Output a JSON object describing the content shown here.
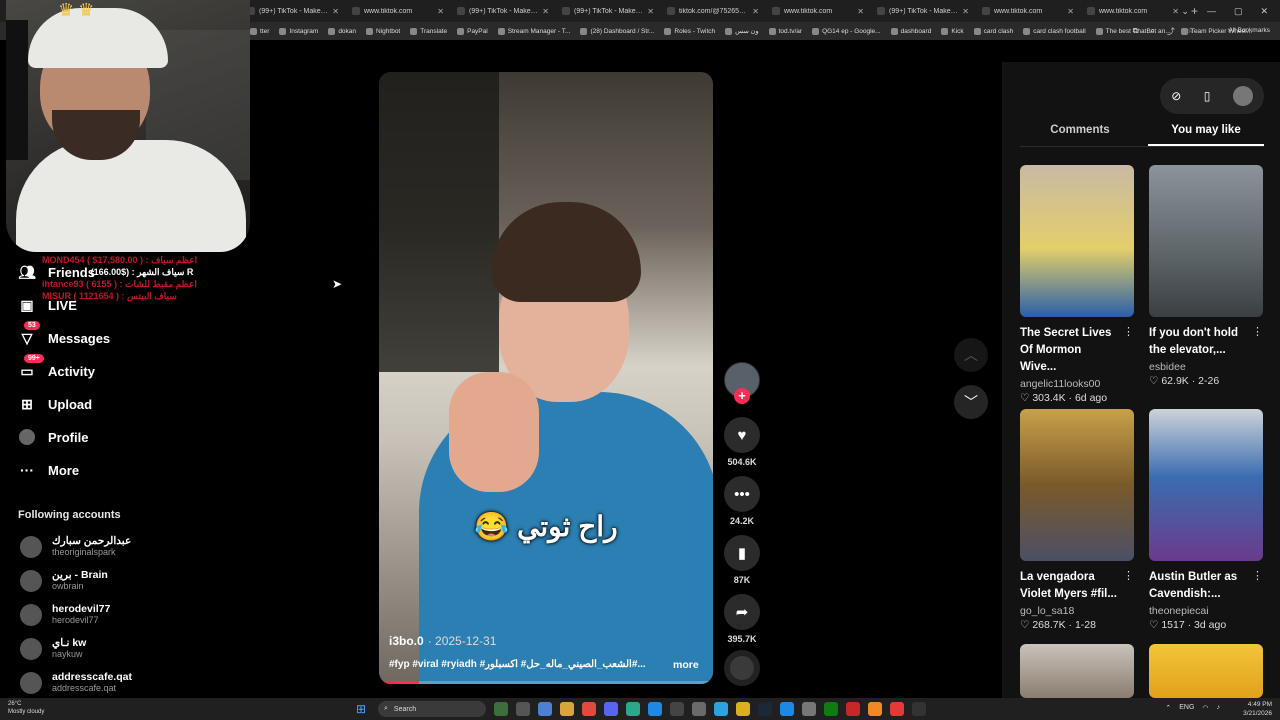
{
  "browser": {
    "tabs": [
      {
        "title": "(99+) TikTok - Make Your"
      },
      {
        "title": "www.tiktok.com"
      },
      {
        "title": "(99+) TikTok - Make Your"
      },
      {
        "title": "(99+) TikTok - Make Your"
      },
      {
        "title": "tiktok.com/@75265481"
      },
      {
        "title": "www.tiktok.com"
      },
      {
        "title": "(99+) TikTok - Make Your"
      },
      {
        "title": "www.tiktok.com"
      },
      {
        "title": "www.tiktok.com"
      }
    ],
    "bookmarks": [
      "tter",
      "Instagram",
      "dokan",
      "Nightbot",
      "Translate",
      "PayPal",
      "Stream Manager - T...",
      "(28) Dashboard / Str...",
      "Roles - Twitch",
      "ون سس",
      "tod.tv/ar",
      "QG14 ep - Google...",
      "dashboard",
      "Kick",
      "card clash",
      "card clash football",
      "The best ChatBot an...",
      "Team Picker Wheel..."
    ],
    "all_bookmarks": "All Bookmarks"
  },
  "stream_overlay": {
    "lines": [
      {
        "text": "MOND454 ( $17,580.00 ) : اعظم سياف",
        "style": "r"
      },
      {
        "text": "سياف الشهر : ($166.00) R",
        "style": "w"
      },
      {
        "text": "ihtance93 ( 6155 ) : اعظم مقبط للشات",
        "style": "r"
      },
      {
        "text": "MISUR ( 1121654 ) : سياف البيتس",
        "style": "r"
      }
    ]
  },
  "nav": {
    "friends": "Friends",
    "live": "LIVE",
    "messages": "Messages",
    "messages_badge": "53",
    "activity": "Activity",
    "activity_badge": "99+",
    "upload": "Upload",
    "profile": "Profile",
    "more": "More"
  },
  "following": {
    "title": "Following accounts",
    "accounts": [
      {
        "name": "عبدالرحمن سبارك",
        "handle": "theoriginalspark"
      },
      {
        "name": "برين - Brain",
        "handle": "owbrain"
      },
      {
        "name": "herodevil77",
        "handle": "herodevil77"
      },
      {
        "name": "نـاي kw",
        "handle": "naykuw"
      },
      {
        "name": "addresscafe.qat",
        "handle": "addresscafe.qat"
      }
    ]
  },
  "video": {
    "caption": "راح ثوتي 😂",
    "author": "i3bo.0",
    "date": "· 2025-12-31",
    "description": "#fyp #viral #ryiadh #الشعب_الصيني_ماله_حل# اكسبلور#...",
    "more": "more",
    "progress": 0.12
  },
  "actions": {
    "likes": "504.6K",
    "comments": "24.2K",
    "saves": "87K",
    "shares": "395.7K"
  },
  "right_panel": {
    "tab_comments": "Comments",
    "tab_you_may_like": "You may like",
    "cards": [
      {
        "title": "The Secret Lives Of Mormon Wive...",
        "author": "angelic11looks00",
        "likes": "303.4K",
        "date": "6d ago"
      },
      {
        "title": "If you don't hold the elevator,...",
        "author": "esbidee",
        "likes": "62.9K",
        "date": "2-26"
      },
      {
        "title": "La vengadora Violet Myers #fil...",
        "author": "go_lo_sa18",
        "likes": "268.7K",
        "date": "1-28"
      },
      {
        "title": "Austin Butler as Cavendish:...",
        "author": "theonepiecai",
        "likes": "1517",
        "date": "3d ago"
      }
    ]
  },
  "taskbar": {
    "weather_temp": "26°C",
    "weather_desc": "Mostly cloudy",
    "search": "Search",
    "lang": "ENG",
    "time": "4:49 PM",
    "date": "3/21/2026"
  },
  "colors": {
    "accent": "#fe2c55",
    "overlay_red": "#c0172a",
    "panel": "#121212"
  }
}
